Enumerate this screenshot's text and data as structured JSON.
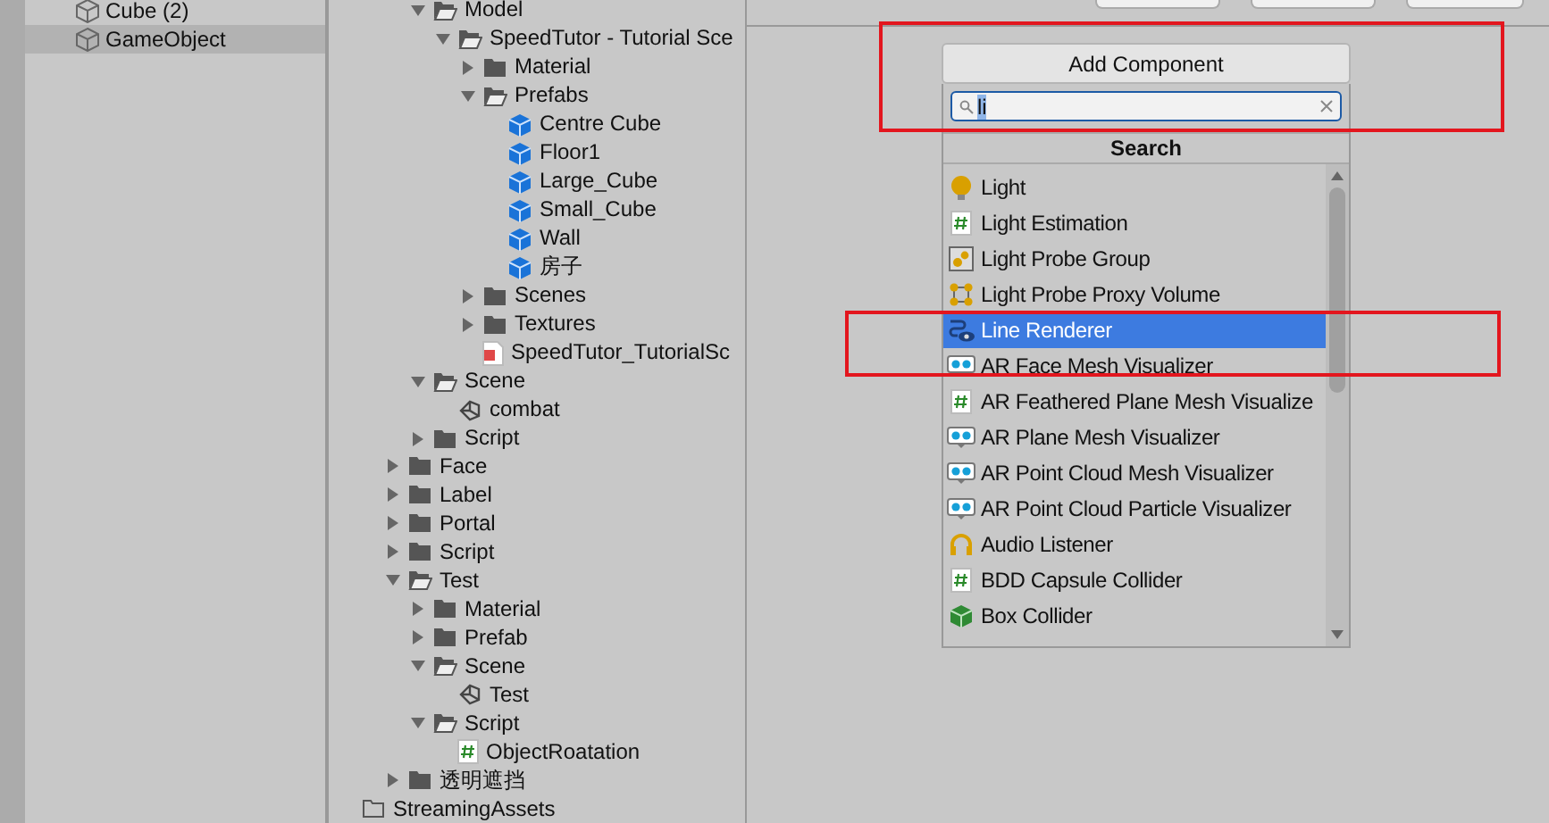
{
  "hierarchy": {
    "items": [
      {
        "label": "Cube (2)",
        "selected": false
      },
      {
        "label": "GameObject",
        "selected": true
      }
    ]
  },
  "project_tree": [
    {
      "children": [
        {
          "children": [
            {
              "label": "Model",
              "kind": "folder",
              "expanded": true,
              "children": [
                {
                  "label": "SpeedTutor - Tutorial Sce",
                  "kind": "folder",
                  "expanded": true,
                  "children": [
                    {
                      "label": "Material",
                      "kind": "folder",
                      "expanded": false
                    },
                    {
                      "label": "Prefabs",
                      "kind": "folder",
                      "expanded": true,
                      "children": [
                        {
                          "label": "Centre Cube",
                          "kind": "prefab"
                        },
                        {
                          "label": "Floor1",
                          "kind": "prefab"
                        },
                        {
                          "label": "Large_Cube",
                          "kind": "prefab"
                        },
                        {
                          "label": "Small_Cube",
                          "kind": "prefab"
                        },
                        {
                          "label": "Wall",
                          "kind": "prefab"
                        },
                        {
                          "label": "房子",
                          "kind": "prefab"
                        }
                      ]
                    },
                    {
                      "label": "Scenes",
                      "kind": "folder",
                      "expanded": false
                    },
                    {
                      "label": "Textures",
                      "kind": "folder",
                      "expanded": false
                    },
                    {
                      "label": "SpeedTutor_TutorialSc",
                      "kind": "document"
                    }
                  ]
                }
              ]
            },
            {
              "label": "Scene",
              "kind": "folder",
              "expanded": true,
              "children": [
                {
                  "label": "combat",
                  "kind": "scene"
                }
              ]
            },
            {
              "label": "Script",
              "kind": "folder",
              "expanded": false
            }
          ]
        },
        {
          "label": "Face",
          "kind": "folder",
          "expanded": false
        },
        {
          "label": "Label",
          "kind": "folder",
          "expanded": false
        },
        {
          "label": "Portal",
          "kind": "folder",
          "expanded": false
        },
        {
          "label": "Script",
          "kind": "folder",
          "expanded": false
        },
        {
          "label": "Test",
          "kind": "folder",
          "expanded": true,
          "children": [
            {
              "label": "Material",
              "kind": "folder",
              "expanded": false
            },
            {
              "label": "Prefab",
              "kind": "folder",
              "expanded": false
            },
            {
              "label": "Scene",
              "kind": "folder",
              "expanded": true,
              "children": [
                {
                  "label": "Test",
                  "kind": "scene"
                }
              ]
            },
            {
              "label": "Script",
              "kind": "folder",
              "expanded": true,
              "children": [
                {
                  "label": "ObjectRoatation",
                  "kind": "script"
                }
              ]
            }
          ]
        },
        {
          "label": "透明遮挡",
          "kind": "folder",
          "expanded": false
        }
      ]
    },
    {
      "label": "StreamingAssets",
      "kind": "empty-folder"
    }
  ],
  "inspector": {
    "add_component_button": "Add Component",
    "search": {
      "value": "li",
      "text_selected": true
    },
    "results_header": "Search",
    "results": [
      {
        "label": "Light",
        "kind": "light",
        "selected": false
      },
      {
        "label": "Light Estimation",
        "kind": "script",
        "selected": false
      },
      {
        "label": "Light Probe Group",
        "kind": "probe-group",
        "selected": false
      },
      {
        "label": "Light Probe Proxy Volume",
        "kind": "probe-volume",
        "selected": false
      },
      {
        "label": "Line Renderer",
        "kind": "line-renderer",
        "selected": true
      },
      {
        "label": "AR Face Mesh Visualizer",
        "kind": "ar",
        "selected": false
      },
      {
        "label": "AR Feathered Plane Mesh Visualize",
        "kind": "script",
        "selected": false
      },
      {
        "label": "AR Plane Mesh Visualizer",
        "kind": "ar",
        "selected": false
      },
      {
        "label": "AR Point Cloud Mesh Visualizer",
        "kind": "ar",
        "selected": false
      },
      {
        "label": "AR Point Cloud Particle Visualizer",
        "kind": "ar",
        "selected": false
      },
      {
        "label": "Audio Listener",
        "kind": "audio",
        "selected": false
      },
      {
        "label": "BDD Capsule Collider",
        "kind": "script",
        "selected": false
      },
      {
        "label": "Box Collider",
        "kind": "box",
        "selected": false
      }
    ]
  }
}
